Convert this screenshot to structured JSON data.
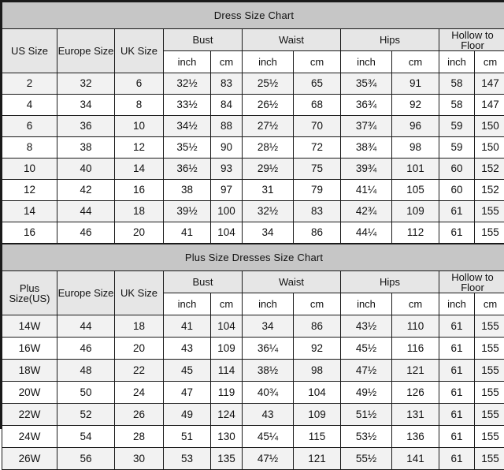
{
  "tables": [
    {
      "title": "Dress Size Chart",
      "size_column_label": "US Size",
      "headers": {
        "us": "US Size",
        "europe": "Europe Size",
        "uk": "UK Size",
        "bust": "Bust",
        "waist": "Waist",
        "hips": "Hips",
        "hollow_to_floor": "Hollow to Floor"
      },
      "units": {
        "bust_inch": "inch",
        "bust_cm": "cm",
        "waist_inch": "inch",
        "waist_cm": "cm",
        "hips_inch": "inch",
        "hips_cm": "cm",
        "hollow_inch": "inch",
        "hollow_cm": "cm"
      },
      "rows": [
        {
          "us": "2",
          "europe": "32",
          "uk": "6",
          "bust_inch": "32½",
          "bust_cm": "83",
          "waist_inch": "25½",
          "waist_cm": "65",
          "hips_inch": "35¾",
          "hips_cm": "91",
          "hollow_inch": "58",
          "hollow_cm": "147"
        },
        {
          "us": "4",
          "europe": "34",
          "uk": "8",
          "bust_inch": "33½",
          "bust_cm": "84",
          "waist_inch": "26½",
          "waist_cm": "68",
          "hips_inch": "36¾",
          "hips_cm": "92",
          "hollow_inch": "58",
          "hollow_cm": "147"
        },
        {
          "us": "6",
          "europe": "36",
          "uk": "10",
          "bust_inch": "34½",
          "bust_cm": "88",
          "waist_inch": "27½",
          "waist_cm": "70",
          "hips_inch": "37¾",
          "hips_cm": "96",
          "hollow_inch": "59",
          "hollow_cm": "150"
        },
        {
          "us": "8",
          "europe": "38",
          "uk": "12",
          "bust_inch": "35½",
          "bust_cm": "90",
          "waist_inch": "28½",
          "waist_cm": "72",
          "hips_inch": "38¾",
          "hips_cm": "98",
          "hollow_inch": "59",
          "hollow_cm": "150"
        },
        {
          "us": "10",
          "europe": "40",
          "uk": "14",
          "bust_inch": "36½",
          "bust_cm": "93",
          "waist_inch": "29½",
          "waist_cm": "75",
          "hips_inch": "39¾",
          "hips_cm": "101",
          "hollow_inch": "60",
          "hollow_cm": "152"
        },
        {
          "us": "12",
          "europe": "42",
          "uk": "16",
          "bust_inch": "38",
          "bust_cm": "97",
          "waist_inch": "31",
          "waist_cm": "79",
          "hips_inch": "41¼",
          "hips_cm": "105",
          "hollow_inch": "60",
          "hollow_cm": "152"
        },
        {
          "us": "14",
          "europe": "44",
          "uk": "18",
          "bust_inch": "39½",
          "bust_cm": "100",
          "waist_inch": "32½",
          "waist_cm": "83",
          "hips_inch": "42¾",
          "hips_cm": "109",
          "hollow_inch": "61",
          "hollow_cm": "155"
        },
        {
          "us": "16",
          "europe": "46",
          "uk": "20",
          "bust_inch": "41",
          "bust_cm": "104",
          "waist_inch": "34",
          "waist_cm": "86",
          "hips_inch": "44¼",
          "hips_cm": "112",
          "hollow_inch": "61",
          "hollow_cm": "155"
        }
      ]
    },
    {
      "title": "Plus Size Dresses Size Chart",
      "size_column_label": "Plus Size(US)",
      "headers": {
        "us": "Plus Size(US)",
        "europe": "Europe Size",
        "uk": "UK Size",
        "bust": "Bust",
        "waist": "Waist",
        "hips": "Hips",
        "hollow_to_floor": "Hollow to Floor"
      },
      "units": {
        "bust_inch": "inch",
        "bust_cm": "cm",
        "waist_inch": "inch",
        "waist_cm": "cm",
        "hips_inch": "inch",
        "hips_cm": "cm",
        "hollow_inch": "inch",
        "hollow_cm": "cm"
      },
      "rows": [
        {
          "us": "14W",
          "europe": "44",
          "uk": "18",
          "bust_inch": "41",
          "bust_cm": "104",
          "waist_inch": "34",
          "waist_cm": "86",
          "hips_inch": "43½",
          "hips_cm": "110",
          "hollow_inch": "61",
          "hollow_cm": "155"
        },
        {
          "us": "16W",
          "europe": "46",
          "uk": "20",
          "bust_inch": "43",
          "bust_cm": "109",
          "waist_inch": "36¼",
          "waist_cm": "92",
          "hips_inch": "45½",
          "hips_cm": "116",
          "hollow_inch": "61",
          "hollow_cm": "155"
        },
        {
          "us": "18W",
          "europe": "48",
          "uk": "22",
          "bust_inch": "45",
          "bust_cm": "114",
          "waist_inch": "38½",
          "waist_cm": "98",
          "hips_inch": "47½",
          "hips_cm": "121",
          "hollow_inch": "61",
          "hollow_cm": "155"
        },
        {
          "us": "20W",
          "europe": "50",
          "uk": "24",
          "bust_inch": "47",
          "bust_cm": "119",
          "waist_inch": "40¾",
          "waist_cm": "104",
          "hips_inch": "49½",
          "hips_cm": "126",
          "hollow_inch": "61",
          "hollow_cm": "155"
        },
        {
          "us": "22W",
          "europe": "52",
          "uk": "26",
          "bust_inch": "49",
          "bust_cm": "124",
          "waist_inch": "43",
          "waist_cm": "109",
          "hips_inch": "51½",
          "hips_cm": "131",
          "hollow_inch": "61",
          "hollow_cm": "155"
        },
        {
          "us": "24W",
          "europe": "54",
          "uk": "28",
          "bust_inch": "51",
          "bust_cm": "130",
          "waist_inch": "45¼",
          "waist_cm": "115",
          "hips_inch": "53½",
          "hips_cm": "136",
          "hollow_inch": "61",
          "hollow_cm": "155"
        },
        {
          "us": "26W",
          "europe": "56",
          "uk": "30",
          "bust_inch": "53",
          "bust_cm": "135",
          "waist_inch": "47½",
          "waist_cm": "121",
          "hips_inch": "55½",
          "hips_cm": "141",
          "hollow_inch": "61",
          "hollow_cm": "155"
        }
      ]
    }
  ],
  "colors": {
    "title_background": "#c6c6c6",
    "group_header_background": "#e6e6e6",
    "row_shaded_background": "#f2f2f2",
    "row_plain_background": "#ffffff",
    "border": "#1a1a1a",
    "text": "#111111"
  }
}
